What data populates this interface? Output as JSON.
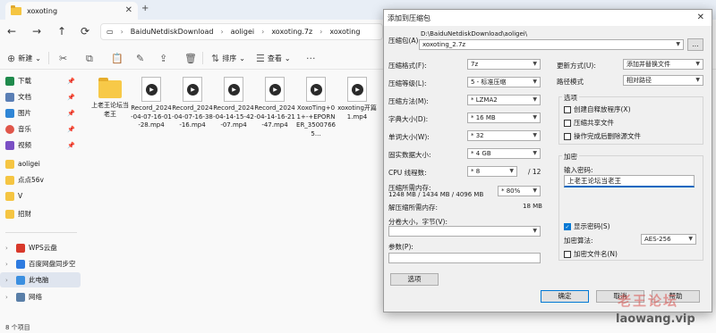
{
  "explorer": {
    "tab_title": "xoxoting",
    "path": [
      "BaiduNetdiskDownload",
      "aoligei",
      "xoxoting.7z",
      "xoxoting"
    ],
    "toolbar": {
      "new_label": "新建",
      "sort_label": "排序",
      "view_label": "查看"
    },
    "sidebar": [
      {
        "label": "下载",
        "pinned": true
      },
      {
        "label": "文档",
        "pinned": true
      },
      {
        "label": "图片",
        "pinned": true
      },
      {
        "label": "音乐",
        "pinned": true
      },
      {
        "label": "视频",
        "pinned": true
      },
      {
        "label": "aoligei"
      },
      {
        "label": "点点56v"
      },
      {
        "label": "V"
      },
      {
        "label": "招财"
      },
      {
        "label": "WPS云盘"
      },
      {
        "label": "百度网盘同步空"
      },
      {
        "label": "此电脑"
      },
      {
        "label": "网络"
      }
    ],
    "files": [
      {
        "name": "上老王论坛当老王",
        "kind": "folder"
      },
      {
        "name": "Record_2024-04-07-16-01-28.mp4",
        "kind": "video"
      },
      {
        "name": "Record_2024-04-07-16-38-16.mp4",
        "kind": "video"
      },
      {
        "name": "Record_2024-04-14-15-42-07.mp4",
        "kind": "video"
      },
      {
        "name": "Record_2024-04-14-16-21-47.mp4",
        "kind": "video"
      },
      {
        "name": "XoxoTing+01+-+EPORNER_35007665...",
        "kind": "video"
      },
      {
        "name": "xoxoting开篇1.mp4",
        "kind": "video"
      }
    ],
    "status": "8 个项目"
  },
  "dialog": {
    "title": "添加到压缩包",
    "archive_label": "压缩包(A):",
    "archive_path": "D:\\BaiduNetdiskDownload\\aoligei\\",
    "archive_name": "xoxoting_2.7z",
    "browse": "...",
    "format_label": "压缩格式(F):",
    "format_value": "7z",
    "level_label": "压缩等级(L):",
    "level_value": "5 - 标准压缩",
    "method_label": "压缩方法(M):",
    "method_value": "* LZMA2",
    "dict_label": "字典大小(D):",
    "dict_value": "* 16 MB",
    "word_label": "单词大小(W):",
    "word_value": "* 32",
    "solid_label": "固实数据大小:",
    "solid_value": "* 4 GB",
    "cpu_label": "CPU 线程数:",
    "cpu_value": "* 8",
    "cpu_total": "/ 12",
    "mem_label": "压缩所需内存:",
    "mem_value": "1248 MB / 1434 MB / 4096 MB",
    "mem_pct": "* 80%",
    "decomp_label": "解压缩所需内存:",
    "decomp_value": "18 MB",
    "split_label": "分卷大小，字节(V):",
    "params_label": "参数(P):",
    "options_button": "选项",
    "update_label": "更新方式(U):",
    "update_value": "添加并替换文件",
    "pathmode_label": "路径模式",
    "pathmode_value": "相对路径",
    "options_group": "选项",
    "opt_sfx": "创建自释放程序(X)",
    "opt_shared": "压缩共享文件",
    "opt_delete": "操作完成后删除源文件",
    "encrypt_group": "加密",
    "pw_label": "输入密码:",
    "pw_value": "上老王论坛当老王",
    "show_pw": "显示密码(S)",
    "enc_method_label": "加密算法:",
    "enc_method_value": "AES-256",
    "enc_names": "加密文件名(N)",
    "ok": "确定",
    "cancel": "取消",
    "help": "帮助"
  },
  "watermark": {
    "cn": "老王论坛",
    "url": "laowang.vip"
  }
}
